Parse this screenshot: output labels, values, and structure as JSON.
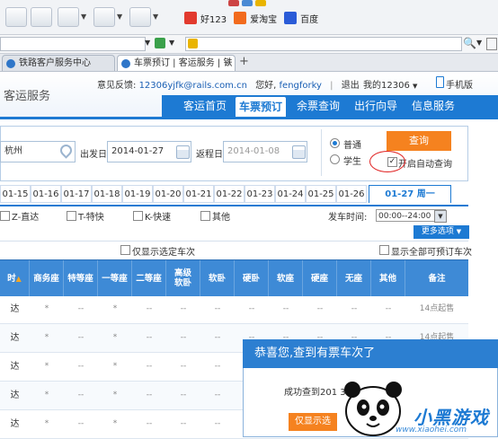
{
  "browser": {
    "fav_links": [
      "好123",
      "爱淘宝",
      "百度"
    ],
    "tabs": [
      {
        "label": "铁路客户服务中心"
      },
      {
        "label": "车票预订 | 客运服务 | 铁"
      }
    ],
    "new_tab": "+",
    "close_glyph": "×"
  },
  "header": {
    "brand_partial": "客运服务",
    "feedback_label": "意见反馈:",
    "feedback_email": "12306yjfk@rails.com.cn",
    "greeting": "您好,",
    "username": "fengforky",
    "separator": "|",
    "logout": "退出",
    "my12306": "我的12306",
    "my12306_arrow": "▼",
    "mobile": "手机版"
  },
  "nav": {
    "items": [
      "客运首页",
      "车票预订",
      "余票查询",
      "出行向导",
      "信息服务"
    ],
    "active_index": 1
  },
  "search": {
    "from_value": "杭州",
    "date_label": "出发日",
    "date_value": "2014-01-27",
    "return_label": "返程日",
    "return_value": "2014-01-08",
    "radio_normal": "普通",
    "radio_student": "学生",
    "query_button": "查询",
    "auto_query_label": "开启自动查询",
    "auto_query_check": "✓"
  },
  "dates": {
    "tabs": [
      "01-15",
      "01-16",
      "01-17",
      "01-18",
      "01-19",
      "01-20",
      "01-21",
      "01-22",
      "01-23",
      "01-24",
      "01-25",
      "01-26"
    ],
    "current": "01-27 周一"
  },
  "filters": {
    "types": [
      "Z-直达",
      "T-特快",
      "K-快速",
      "其他"
    ],
    "depart_time_label": "发车时间:",
    "depart_time_value": "00:00--24:00",
    "dropdown_glyph": "▼",
    "more_options": "更多选项",
    "only_selected": "仅显示选定车次",
    "show_bookable": "显示全部可预订车次"
  },
  "table": {
    "header_partial": "时",
    "sort_glyph": "▲",
    "columns": [
      "商务座",
      "特等座",
      "一等座",
      "二等座",
      "高级\n软卧",
      "软卧",
      "硬卧",
      "软座",
      "硬座",
      "无座",
      "其他",
      "备注"
    ],
    "rows": [
      {
        "station": "达",
        "cells": [
          "*",
          "--",
          "*",
          "--",
          "--",
          "--",
          "--",
          "--",
          "--",
          "--",
          "--"
        ],
        "note": "14点起售"
      },
      {
        "station": "达",
        "cells": [
          "*",
          "--",
          "*",
          "--",
          "--",
          "--",
          "--",
          "--",
          "--",
          "--",
          "--"
        ],
        "note": "14点起售"
      },
      {
        "station": "达",
        "cells": [
          "*",
          "--",
          "*",
          "--",
          "--",
          "--",
          "--",
          "--",
          "--",
          "--",
          "--"
        ],
        "note": ""
      },
      {
        "station": "达",
        "cells": [
          "*",
          "--",
          "*",
          "--",
          "--",
          "--",
          "--",
          "--",
          "--",
          "--",
          "--"
        ],
        "note": ""
      },
      {
        "station": "达",
        "cells": [
          "*",
          "--",
          "*",
          "--",
          "--",
          "--",
          "--",
          "--",
          "--",
          "--",
          "--"
        ],
        "note": ""
      }
    ]
  },
  "popup": {
    "title": "恭喜您,查到有票车次了",
    "message": "成功查到201    31次车",
    "button": "仅显示选"
  },
  "watermark": {
    "text": "小黑游戏",
    "url": "www.xiaohei.com"
  }
}
